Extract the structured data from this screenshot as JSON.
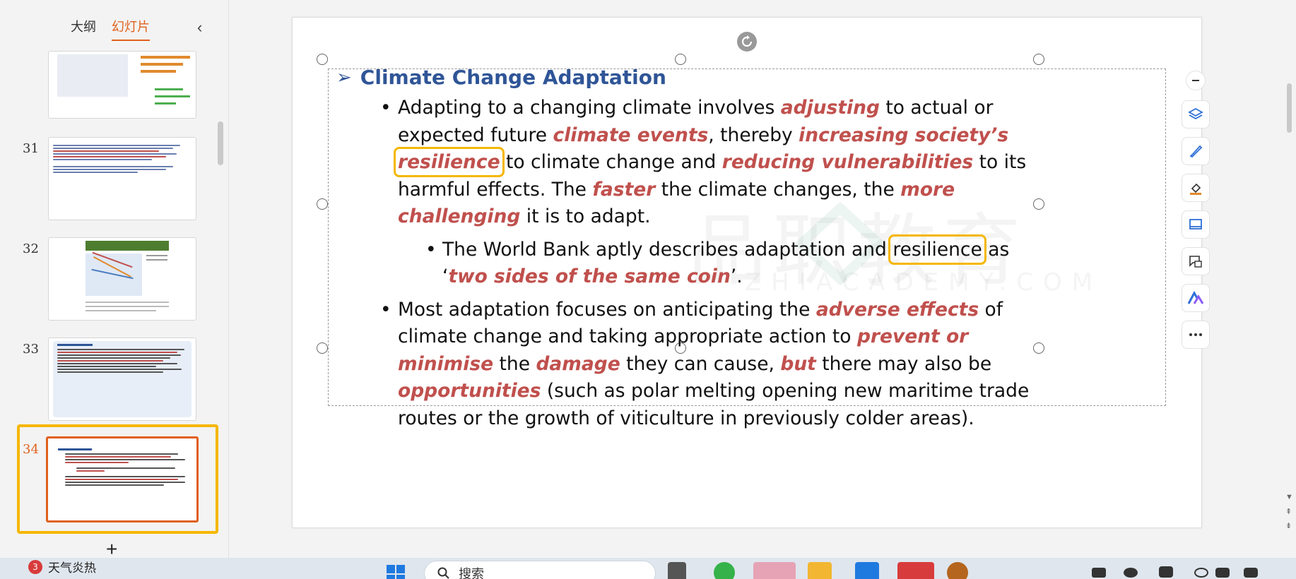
{
  "panel": {
    "tabs": [
      {
        "label": "大纲"
      },
      {
        "label": "幻灯片"
      }
    ],
    "collapse_icon": "chevron-left-icon",
    "slides": [
      {
        "number": "31"
      },
      {
        "number": "32"
      },
      {
        "number": "33"
      },
      {
        "number": "34"
      }
    ],
    "add_label": "+"
  },
  "slide": {
    "title": "Climate Change Adaptation",
    "bullet1": {
      "t1": "Adapting to a changing climate involves ",
      "e1": "adjusting",
      "t2": " to actual or expected future ",
      "e2": "climate events",
      "t3": ", thereby ",
      "e3": "increasing society’s",
      "t3b": " ",
      "e4": "resilience",
      "t4": " to climate change and ",
      "e5": "reducing vulnerabilities",
      "t5": " to its harmful effects. The ",
      "e6": "faster",
      "t6": " the climate changes, the ",
      "e7": "more challenging",
      "t7": " it is to adapt."
    },
    "bullet2": {
      "t1": "The World Bank aptly describes adaptation and ",
      "boxed": "resilience",
      "t2": " as ‘",
      "e1": "two sides of the same coin",
      "t3": "’."
    },
    "bullet3": {
      "t1": "Most adaptation focuses on anticipating the ",
      "e1": "adverse effects",
      "t2": " of climate change and taking appropriate action to ",
      "e2": "prevent or minimise",
      "t3": " the ",
      "e3": "damage",
      "t4": " they can cause, ",
      "e4": "but",
      "t5": " there may also be ",
      "e5": "opportunities",
      "t6": " (such as polar melting opening new maritime trade routes or the growth of viticulture in previously colder areas)."
    },
    "highlight_color": "#c0504d",
    "title_color": "#2f5597",
    "annotation_color": "#f5b700"
  },
  "tools": {
    "icons": [
      "minus-icon",
      "layers-icon",
      "brush-icon",
      "clear-format-icon",
      "slide-layout-icon",
      "comment-icon",
      "ai-assistant-icon",
      "more-icon"
    ]
  },
  "taskbar": {
    "weather_count": "3",
    "weather_text": "天气炎热",
    "search_placeholder": "搜索"
  }
}
